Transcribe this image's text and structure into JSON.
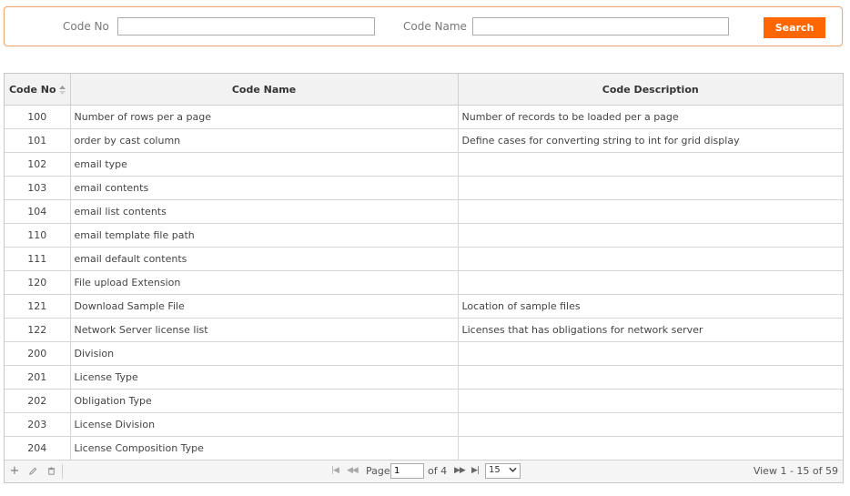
{
  "search": {
    "code_no_label": "Code No",
    "code_no_value": "",
    "code_name_label": "Code Name",
    "code_name_value": "",
    "button_label": "Search"
  },
  "grid": {
    "columns": [
      "Code No",
      "Code Name",
      "Code Description"
    ],
    "rows": [
      [
        "100",
        "Number of rows per a page",
        "Number of records to be loaded per a page"
      ],
      [
        "101",
        "order by cast column",
        "Define cases for converting string to int for grid display"
      ],
      [
        "102",
        "email type",
        ""
      ],
      [
        "103",
        "email contents",
        ""
      ],
      [
        "104",
        "email list contents",
        ""
      ],
      [
        "110",
        "email template file path",
        ""
      ],
      [
        "111",
        "email default contents",
        ""
      ],
      [
        "120",
        "File upload Extension",
        ""
      ],
      [
        "121",
        "Download Sample File",
        "Location of sample files"
      ],
      [
        "122",
        "Network Server license list",
        "Licenses that has obligations for network server"
      ],
      [
        "200",
        "Division",
        ""
      ],
      [
        "201",
        "License Type",
        ""
      ],
      [
        "202",
        "Obligation Type",
        ""
      ],
      [
        "203",
        "License Division",
        ""
      ],
      [
        "204",
        "License Composition Type",
        ""
      ]
    ]
  },
  "pager": {
    "page_label": "Page",
    "page_value": "1",
    "of_label": "of 4",
    "rows_per_page": "15",
    "view_text": "View 1 - 15 of 59"
  },
  "colors": {
    "accent": "#ff6600",
    "panel_border": "#f0a878"
  }
}
